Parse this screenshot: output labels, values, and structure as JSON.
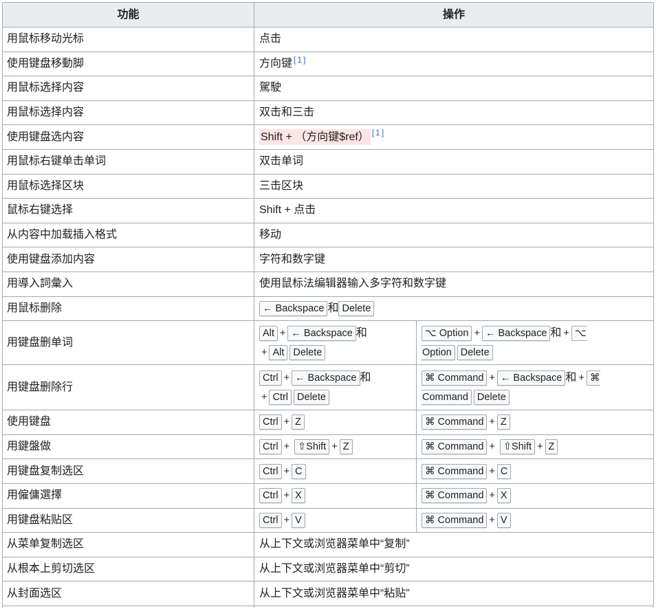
{
  "colors": {
    "text": "#202122",
    "border": "#a2a9b1",
    "header_bg": "#eaecf0",
    "kbd_bg": "#f8f9fa",
    "link": "#3366cc",
    "highlight": "#fde5e3"
  },
  "header": {
    "function": "功能",
    "operation": "操作"
  },
  "rows": [
    {
      "function": "用鼠标移动光标",
      "operation": "点击"
    },
    {
      "function": "使用键盘移動脚",
      "operation": "方向键",
      "ref": "[1]"
    },
    {
      "function": "用鼠标选择内容",
      "operation": "駕駛"
    },
    {
      "function": "用鼠标选择内容",
      "operation": "双击和三击"
    },
    {
      "function": "使用键盘选内容",
      "operation": "Shift + （方向键$ref）",
      "ref": "[1]"
    },
    {
      "function": "用鼠标右键单击单词",
      "operation": "双击单词"
    },
    {
      "function": "用鼠标选择区块",
      "operation": "三击区块"
    },
    {
      "function": "鼠标右键选择",
      "operation": "Shift + 点击"
    },
    {
      "function": "从内容中加载插入格式",
      "operation": "移动"
    },
    {
      "function": "使用键盘添加内容",
      "operation": "字符和数字键"
    },
    {
      "function": "用導入詞彙入",
      "operation": "使用鼠标法编辑器输入多字符和数字键"
    },
    {
      "function": "用鼠标删除",
      "operation": [
        "← Backspace",
        "和",
        "Delete"
      ]
    },
    {
      "function": "用键盘删单词",
      "windows": [
        [
          "Alt",
          "+",
          "← Backspace",
          "和"
        ],
        [
          "+",
          "Alt",
          "Delete"
        ]
      ],
      "mac": [
        [
          "⌥ Option",
          "+",
          "← Backspace",
          "和",
          "+",
          "⌥"
        ],
        [
          "Option",
          "Delete"
        ]
      ]
    },
    {
      "function": "用键盘删除行",
      "windows": [
        [
          "Ctrl",
          "+",
          "← Backspace",
          "和"
        ],
        [
          "+",
          "Ctrl",
          "Delete"
        ]
      ],
      "mac": [
        [
          "⌘ Command",
          "+",
          "← Backspace",
          "和",
          "+",
          "⌘"
        ],
        [
          "Command",
          "Delete"
        ]
      ]
    },
    {
      "function": "使用键盘",
      "windows": [
        "Ctrl",
        "+",
        "Z"
      ],
      "mac": [
        "⌘ Command",
        "+",
        "Z"
      ]
    },
    {
      "function": "用鍵盤做",
      "windows": [
        "Ctrl",
        "+",
        "⇧Shift",
        "+",
        "Z"
      ],
      "mac": [
        "⌘ Command",
        "+",
        "⇧Shift",
        "+",
        "Z"
      ]
    },
    {
      "function": "用键盘复制选区",
      "windows": [
        "Ctrl",
        "+",
        "C"
      ],
      "mac": [
        "⌘ Command",
        "+",
        "C"
      ]
    },
    {
      "function": "用僱傭選擇",
      "windows": [
        "Ctrl",
        "+",
        "X"
      ],
      "mac": [
        "⌘ Command",
        "+",
        "X"
      ]
    },
    {
      "function": "用键盘粘贴区",
      "windows": [
        "Ctrl",
        "+",
        "V"
      ],
      "mac": [
        "⌘ Command",
        "+",
        "V"
      ]
    },
    {
      "function": "从菜单复制选区",
      "operation": "从上下文或浏览器菜单中“复制”"
    },
    {
      "function": "从根本上剪切选区",
      "operation": "从上下文或浏览器菜单中“剪切”"
    },
    {
      "function": "从封面选区",
      "operation": "从上下文或浏览器菜单中“粘贴”"
    }
  ]
}
